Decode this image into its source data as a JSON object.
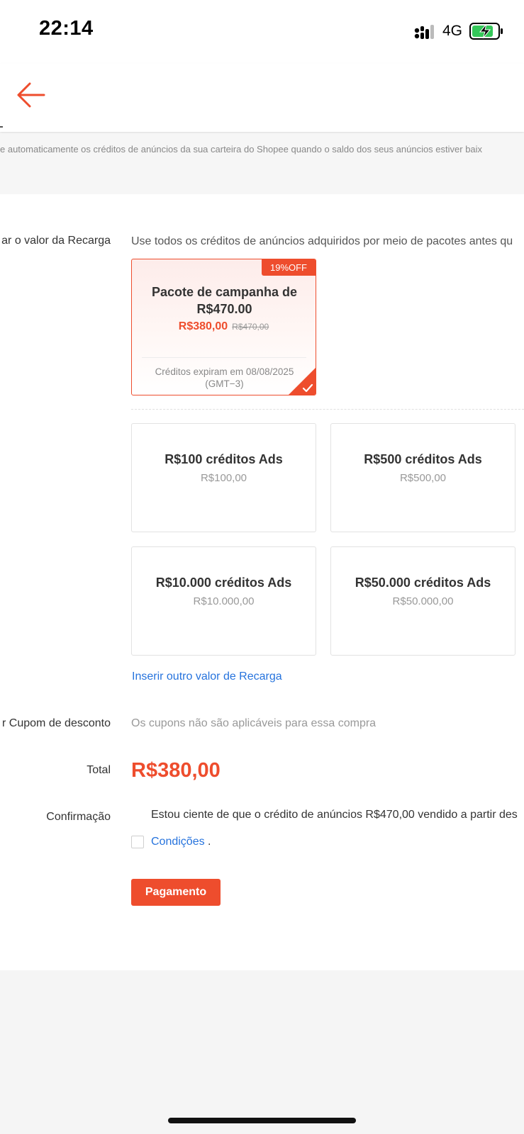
{
  "status": {
    "time": "22:14",
    "network": "4G"
  },
  "info_text": "e automaticamente os créditos de anúncios da sua carteira do Shopee quando o saldo dos seus anúncios estiver baix",
  "form": {
    "recarga_label": "ar o valor da Recarga",
    "rule_text": "Use todos os créditos de anúncios adquiridos por meio de pacotes antes qu",
    "campaign": {
      "badge": "19%OFF",
      "title": "Pacote de campanha de R$470.00",
      "price": "R$380,00",
      "original_price": "R$470,00",
      "expiry": "Créditos expiram em 08/08/2025 (GMT−3)",
      "selected": true
    },
    "options": [
      {
        "title": "R$100 créditos Ads",
        "price": "R$100,00"
      },
      {
        "title": "R$500 créditos Ads",
        "price": "R$500,00"
      },
      {
        "title": "R$10.000 créditos Ads",
        "price": "R$10.000,00"
      },
      {
        "title": "R$50.000 créditos Ads",
        "price": "R$50.000,00"
      }
    ],
    "other_value_link": "Inserir outro valor de Recarga",
    "coupon_label": "r Cupom de desconto",
    "coupon_text": "Os cupons não são aplicáveis para essa compra",
    "total_label": "Total",
    "total_value": "R$380,00",
    "confirm_label": "Confirmação",
    "confirm_text": "Estou ciente de que o crédito de anúncios R$470,00 vendido a partir des",
    "conditions_link": "Condições",
    "conditions_suffix": " .",
    "pay_button": "Pagamento"
  },
  "colors": {
    "accent": "#ee4d2d",
    "link": "#2673dd"
  },
  "icons": {
    "back": "arrow-left-icon",
    "check": "checkmark-icon"
  }
}
